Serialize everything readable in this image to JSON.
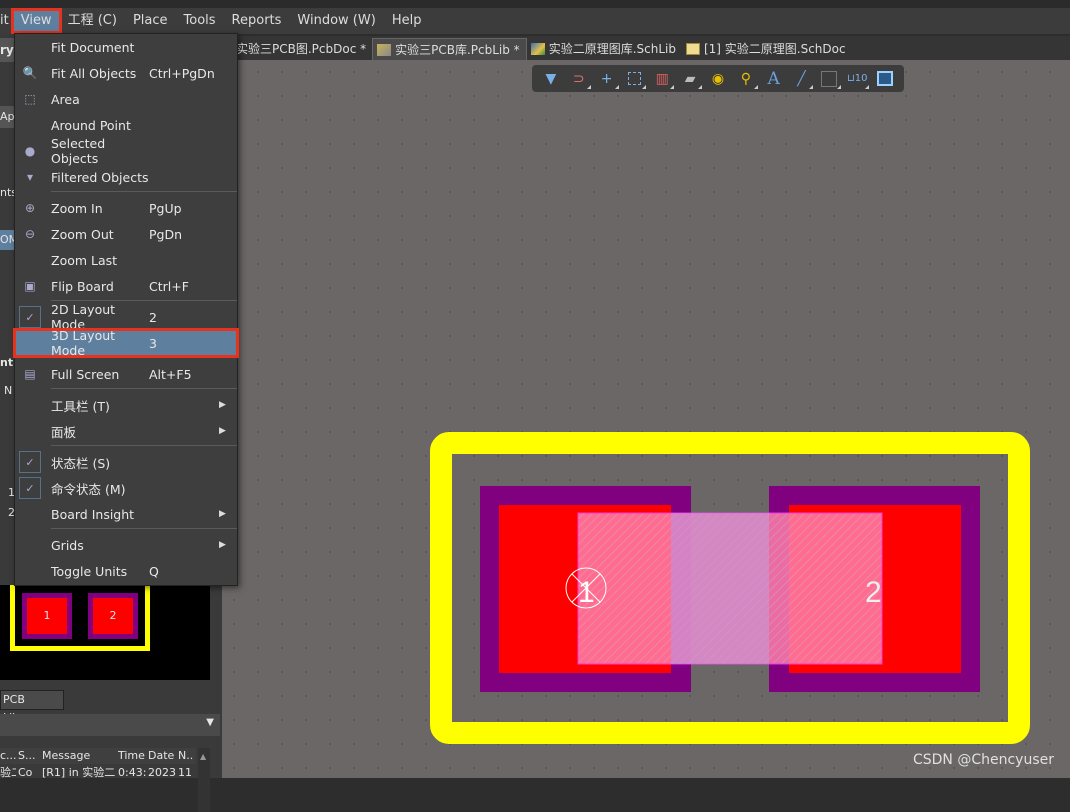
{
  "menubar": {
    "items": [
      "it",
      "View",
      "工程 (C)",
      "Place",
      "Tools",
      "Reports",
      "Window (W)",
      "Help"
    ],
    "active": "View"
  },
  "tabs": [
    {
      "label": "实验三PCB图.PcbDoc *",
      "active": false
    },
    {
      "label": "实验三PCB库.PcbLib *",
      "active": true
    },
    {
      "label": "实验二原理图库.SchLib",
      "active": false
    },
    {
      "label": "[1] 实验二原理图.SchDoc",
      "active": false
    }
  ],
  "toolbar": {
    "icons": [
      "filter-icon",
      "interactive-route-icon",
      "cross-icon",
      "select-rect-icon",
      "align-icon",
      "component-icon",
      "pad-icon",
      "via-icon",
      "text-icon",
      "line-icon",
      "dimension-icon",
      "coordinate-icon",
      "region-icon"
    ]
  },
  "view_menu": {
    "items": [
      {
        "label": "Fit Document",
        "shortcut": "",
        "icon": ""
      },
      {
        "label": "Fit All Objects",
        "shortcut": "Ctrl+PgDn",
        "icon": "fit-all-icon"
      },
      {
        "label": "Area",
        "shortcut": "",
        "icon": "zoom-area-icon"
      },
      {
        "label": "Around Point",
        "shortcut": "",
        "icon": ""
      },
      {
        "label": "Selected Objects",
        "shortcut": "",
        "icon": "zoom-selected-icon"
      },
      {
        "label": "Filtered Objects",
        "shortcut": "",
        "icon": "zoom-filtered-icon"
      },
      {
        "label": "Zoom In",
        "shortcut": "PgUp",
        "icon": "zoom-in-icon"
      },
      {
        "label": "Zoom Out",
        "shortcut": "PgDn",
        "icon": "zoom-out-icon"
      },
      {
        "label": "Zoom Last",
        "shortcut": "",
        "icon": ""
      },
      {
        "label": "Flip Board",
        "shortcut": "Ctrl+F",
        "icon": "flip-board-icon"
      },
      {
        "label": "2D Layout Mode",
        "shortcut": "2",
        "checked": true
      },
      {
        "label": "3D Layout Mode",
        "shortcut": "3",
        "highlighted": true
      },
      {
        "label": "Full Screen",
        "shortcut": "Alt+F5",
        "icon": "full-screen-icon"
      },
      {
        "label": "工具栏 (T)",
        "submenu": true
      },
      {
        "label": "面板",
        "submenu": true
      },
      {
        "label": "状态栏 (S)",
        "checked": true
      },
      {
        "label": "命令状态 (M)",
        "checked": true
      },
      {
        "label": "Board Insight",
        "submenu": true
      },
      {
        "label": "Grids",
        "submenu": true
      },
      {
        "label": "Toggle Units",
        "shortcut": "Q"
      }
    ]
  },
  "left_panel": {
    "fragments": [
      "ry",
      "App",
      "nts",
      "OM",
      "nt I",
      "N",
      "1",
      "2"
    ],
    "tab": "PCB Library",
    "preview_pads": [
      "1",
      "2"
    ],
    "messages": {
      "headers": [
        "c...",
        "S...",
        "Message",
        "Time",
        "Date",
        "N.."
      ],
      "row": [
        "验二",
        "Co",
        "[R1] in 实验二",
        "0:43:",
        "2023,",
        "11"
      ]
    }
  },
  "pcb": {
    "pad_labels": [
      "1",
      "2"
    ],
    "colors": {
      "outline": "#ffff00",
      "pad_mask": "#800080",
      "pad": "#ff0000",
      "body": "#ff7fb0"
    }
  },
  "watermark": "CSDN @Chencyuser"
}
